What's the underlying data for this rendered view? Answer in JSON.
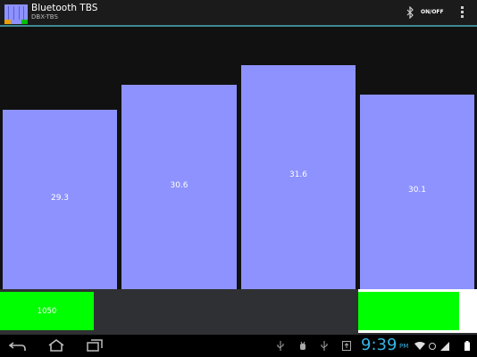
{
  "app": {
    "title": "Bluetooth TBS",
    "subtitle": "DBX-TBS",
    "onoff_label": "ON/OFF",
    "icons": [
      "app-icon",
      "bluetooth-icon",
      "overflow-menu-icon"
    ]
  },
  "bars": [
    {
      "label": "29.3",
      "value": 29.3
    },
    {
      "label": "30.6",
      "value": 30.6
    },
    {
      "label": "31.6",
      "value": 31.6
    },
    {
      "label": "30.1",
      "value": 30.1
    }
  ],
  "bottom_gauges": [
    {
      "label": "1050",
      "fill": 0.8
    },
    {
      "label": "",
      "fill": 0.88
    }
  ],
  "colors": {
    "bar": "#8d92ff",
    "gauge": "#00ff00",
    "accent_line": "#3d8a92",
    "clock": "#34b5e5",
    "background": "#111111"
  },
  "status_bar": {
    "time": "9:39",
    "ampm": "PM",
    "icons": [
      "usb-icon",
      "debug-icon",
      "notification-icon",
      "wifi-icon",
      "signal-icon",
      "battery-icon"
    ]
  },
  "nav": {
    "icons": [
      "back-icon",
      "home-icon",
      "recent-apps-icon"
    ]
  }
}
